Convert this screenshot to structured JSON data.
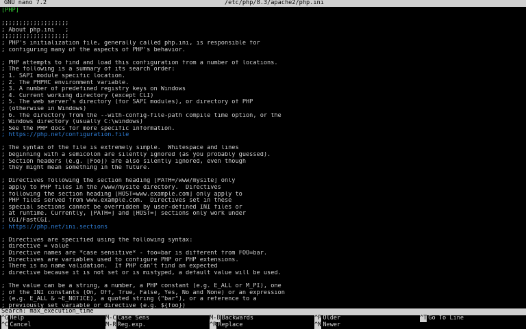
{
  "titlebar": {
    "app": "GNU nano 7.2",
    "file": "/etc/php/8.3/apache2/php.ini"
  },
  "editor": {
    "lines": [
      {
        "text": "[PHP]",
        "kind": "section"
      },
      {
        "text": "",
        "kind": "blank"
      },
      {
        "text": ";;;;;;;;;;;;;;;;;;;",
        "kind": "comment"
      },
      {
        "text": "; About php.ini   ;",
        "kind": "comment"
      },
      {
        "text": ";;;;;;;;;;;;;;;;;;;",
        "kind": "comment"
      },
      {
        "text": "; PHP's initialization file, generally called php.ini, is responsible for",
        "kind": "comment"
      },
      {
        "text": "; configuring many of the aspects of PHP's behavior.",
        "kind": "comment"
      },
      {
        "text": "",
        "kind": "blank"
      },
      {
        "text": "; PHP attempts to find and load this configuration from a number of locations.",
        "kind": "comment"
      },
      {
        "text": "; The following is a summary of its search order:",
        "kind": "comment"
      },
      {
        "text": "; 1. SAPI module specific location.",
        "kind": "comment"
      },
      {
        "text": "; 2. The PHPRC environment variable.",
        "kind": "comment"
      },
      {
        "text": "; 3. A number of predefined registry keys on Windows",
        "kind": "comment"
      },
      {
        "text": "; 4. Current working directory (except CLI)",
        "kind": "comment"
      },
      {
        "text": "; 5. The web server's directory (for SAPI modules), or directory of PHP",
        "kind": "comment"
      },
      {
        "text": "; (otherwise in Windows)",
        "kind": "comment"
      },
      {
        "text": "; 6. The directory from the --with-config-file-path compile time option, or the",
        "kind": "comment"
      },
      {
        "text": "; Windows directory (usually C:\\windows)",
        "kind": "comment"
      },
      {
        "text": "; See the PHP docs for more specific information.",
        "kind": "comment"
      },
      {
        "text": "; https://php.net/configuration.file",
        "kind": "link"
      },
      {
        "text": "",
        "kind": "blank"
      },
      {
        "text": "; The syntax of the file is extremely simple.  Whitespace and lines",
        "kind": "comment"
      },
      {
        "text": "; beginning with a semicolon are silently ignored (as you probably guessed).",
        "kind": "comment"
      },
      {
        "text": "; Section headers (e.g. [Foo]) are also silently ignored, even though",
        "kind": "comment"
      },
      {
        "text": "; they might mean something in the future.",
        "kind": "comment"
      },
      {
        "text": "",
        "kind": "blank"
      },
      {
        "text": "; Directives following the section heading [PATH=/www/mysite] only",
        "kind": "comment"
      },
      {
        "text": "; apply to PHP files in the /www/mysite directory.  Directives",
        "kind": "comment"
      },
      {
        "text": "; following the section heading [HOST=www.example.com] only apply to",
        "kind": "comment"
      },
      {
        "text": "; PHP files served from www.example.com.  Directives set in these",
        "kind": "comment"
      },
      {
        "text": "; special sections cannot be overridden by user-defined INI files or",
        "kind": "comment"
      },
      {
        "text": "; at runtime. Currently, [PATH=] and [HOST=] sections only work under",
        "kind": "comment"
      },
      {
        "text": "; CGI/FastCGI.",
        "kind": "comment"
      },
      {
        "text": "; https://php.net/ini.sections",
        "kind": "link"
      },
      {
        "text": "",
        "kind": "blank"
      },
      {
        "text": "; Directives are specified using the following syntax:",
        "kind": "comment"
      },
      {
        "text": "; directive = value",
        "kind": "comment"
      },
      {
        "text": "; Directive names are *case sensitive* - foo=bar is different from FOO=bar.",
        "kind": "comment"
      },
      {
        "text": "; Directives are variables used to configure PHP or PHP extensions.",
        "kind": "comment"
      },
      {
        "text": "; There is no name validation.  If PHP can't find an expected",
        "kind": "comment"
      },
      {
        "text": "; directive because it is not set or is mistyped, a default value will be used.",
        "kind": "comment"
      },
      {
        "text": "",
        "kind": "blank"
      },
      {
        "text": "; The value can be a string, a number, a PHP constant (e.g. E_ALL or M_PI), one",
        "kind": "comment"
      },
      {
        "text": "; of the INI constants (On, Off, True, False, Yes, No and None) or an expression",
        "kind": "comment"
      },
      {
        "text": "; (e.g. E_ALL & ~E_NOTICE), a quoted string (\"bar\"), or a reference to a",
        "kind": "comment"
      },
      {
        "text": "; previously set variable or directive (e.g. ${foo})",
        "kind": "comment"
      }
    ]
  },
  "search": {
    "label": "Search: max_execution_time"
  },
  "shortcuts": [
    {
      "key": "^G",
      "label": "Help",
      "row": 0,
      "col": 0
    },
    {
      "key": "M-C",
      "label": "Case Sens",
      "row": 0,
      "col": 1
    },
    {
      "key": "M-B",
      "label": "Backwards",
      "row": 0,
      "col": 2
    },
    {
      "key": "^P",
      "label": "Older",
      "row": 0,
      "col": 3
    },
    {
      "key": "^T",
      "label": "Go To Line",
      "row": 0,
      "col": 4
    },
    {
      "key": "^C",
      "label": "Cancel",
      "row": 1,
      "col": 0
    },
    {
      "key": "M-R",
      "label": "Reg.exp.",
      "row": 1,
      "col": 1
    },
    {
      "key": "^R",
      "label": "Replace",
      "row": 1,
      "col": 2
    },
    {
      "key": "^N",
      "label": "Newer",
      "row": 1,
      "col": 3
    }
  ],
  "colors": {
    "section": "#33cc33",
    "link": "#2f7fd8",
    "bar": "#d0d0d0"
  }
}
